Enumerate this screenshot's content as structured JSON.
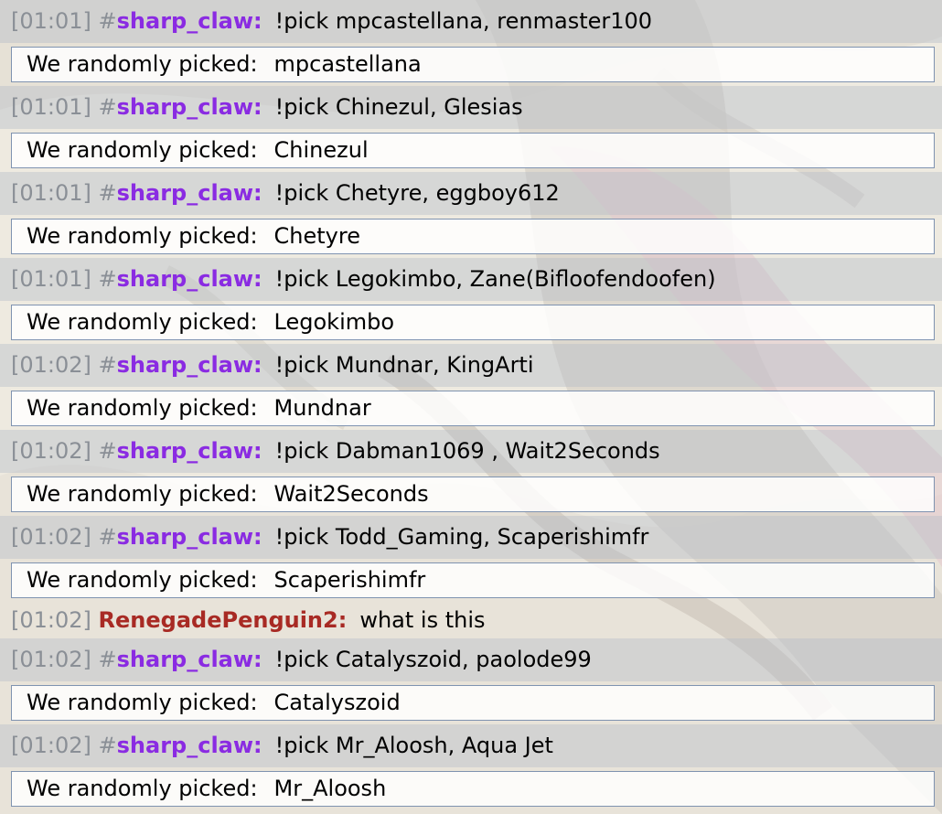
{
  "messages": [
    {
      "type": "chat",
      "shade": true,
      "time": "[01:01]",
      "hash": "#",
      "user": "sharp_claw:",
      "userColor": "#8a2be2",
      "text": "!pick mpcastellana, renmaster100"
    },
    {
      "type": "raw",
      "label": "We randomly picked:",
      "value": "mpcastellana"
    },
    {
      "type": "chat",
      "shade": true,
      "time": "[01:01]",
      "hash": "#",
      "user": "sharp_claw:",
      "userColor": "#8a2be2",
      "text": "!pick Chinezul, Glesias"
    },
    {
      "type": "raw",
      "label": "We randomly picked:",
      "value": "Chinezul"
    },
    {
      "type": "chat",
      "shade": true,
      "time": "[01:01]",
      "hash": "#",
      "user": "sharp_claw:",
      "userColor": "#8a2be2",
      "text": "!pick Chetyre, eggboy612"
    },
    {
      "type": "raw",
      "label": "We randomly picked:",
      "value": "Chetyre"
    },
    {
      "type": "chat",
      "shade": true,
      "time": "[01:01]",
      "hash": "#",
      "user": "sharp_claw:",
      "userColor": "#8a2be2",
      "text": "!pick Legokimbo, Zane(Bifloofendoofen)"
    },
    {
      "type": "raw",
      "label": "We randomly picked:",
      "value": "Legokimbo"
    },
    {
      "type": "chat",
      "shade": true,
      "time": "[01:02]",
      "hash": "#",
      "user": "sharp_claw:",
      "userColor": "#8a2be2",
      "text": "!pick Mundnar, KingArti"
    },
    {
      "type": "raw",
      "label": "We randomly picked:",
      "value": "Mundnar"
    },
    {
      "type": "chat",
      "shade": true,
      "time": "[01:02]",
      "hash": "#",
      "user": "sharp_claw:",
      "userColor": "#8a2be2",
      "text": "!pick Dabman1069 , Wait2Seconds"
    },
    {
      "type": "raw",
      "label": "We randomly picked:",
      "value": "Wait2Seconds"
    },
    {
      "type": "chat",
      "shade": true,
      "time": "[01:02]",
      "hash": "#",
      "user": "sharp_claw:",
      "userColor": "#8a2be2",
      "text": "!pick Todd_Gaming, Scaperishimfr"
    },
    {
      "type": "raw",
      "label": "We randomly picked:",
      "value": "Scaperishimfr"
    },
    {
      "type": "chat",
      "shade": false,
      "time": "[01:02]",
      "hash": "",
      "user": "RenegadePenguin2:",
      "userColor": "#a82a24",
      "text": "what is this"
    },
    {
      "type": "chat",
      "shade": true,
      "time": "[01:02]",
      "hash": "#",
      "user": "sharp_claw:",
      "userColor": "#8a2be2",
      "text": "!pick Catalyszoid, paolode99"
    },
    {
      "type": "raw",
      "label": "We randomly picked:",
      "value": "Catalyszoid"
    },
    {
      "type": "chat",
      "shade": true,
      "time": "[01:02]",
      "hash": "#",
      "user": "sharp_claw:",
      "userColor": "#8a2be2",
      "text": "!pick Mr_Aloosh, Aqua Jet"
    },
    {
      "type": "raw",
      "label": "We randomly picked:",
      "value": "Mr_Aloosh"
    }
  ]
}
